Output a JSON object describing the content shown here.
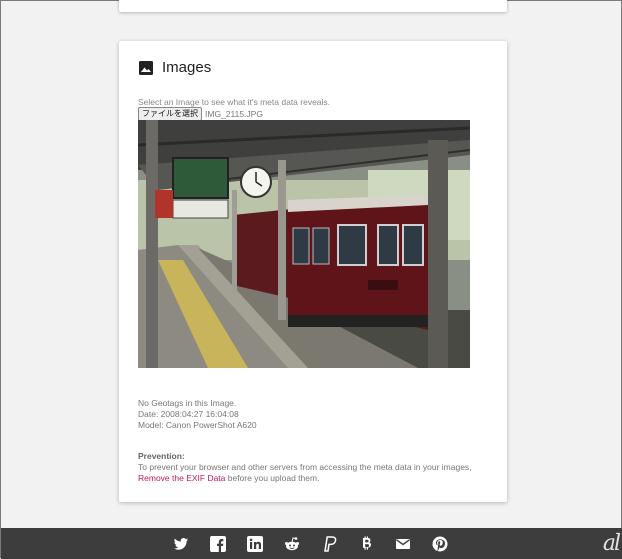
{
  "card": {
    "title": "Images",
    "icon": "image-icon"
  },
  "uploader": {
    "help_text": "Select an Image to see what it's meta data reveals.",
    "file_button": "ファイルを選択",
    "file_name": "IMG_2115.JPG"
  },
  "results": {
    "geotags": "No Geotags in this Image.",
    "date": "Date: 2008:04:27 16:04:08",
    "model": "Model: Canon PowerShot A620"
  },
  "prevention": {
    "title": "Prevention:",
    "text_before": "To prevent your browser and other servers from accessing the meta data in your images, ",
    "link": "Remove the EXIF Data",
    "text_after": " before you upload them."
  },
  "footer": {
    "icons": [
      "twitter-icon",
      "facebook-icon",
      "linkedin-icon",
      "reddit-icon",
      "paypal-icon",
      "bitcoin-icon",
      "email-icon",
      "pinterest-icon"
    ]
  },
  "colors": {
    "link": "#c2185b",
    "footer_bg": "#3d3d3d",
    "page_bg": "#f2f2f2"
  }
}
